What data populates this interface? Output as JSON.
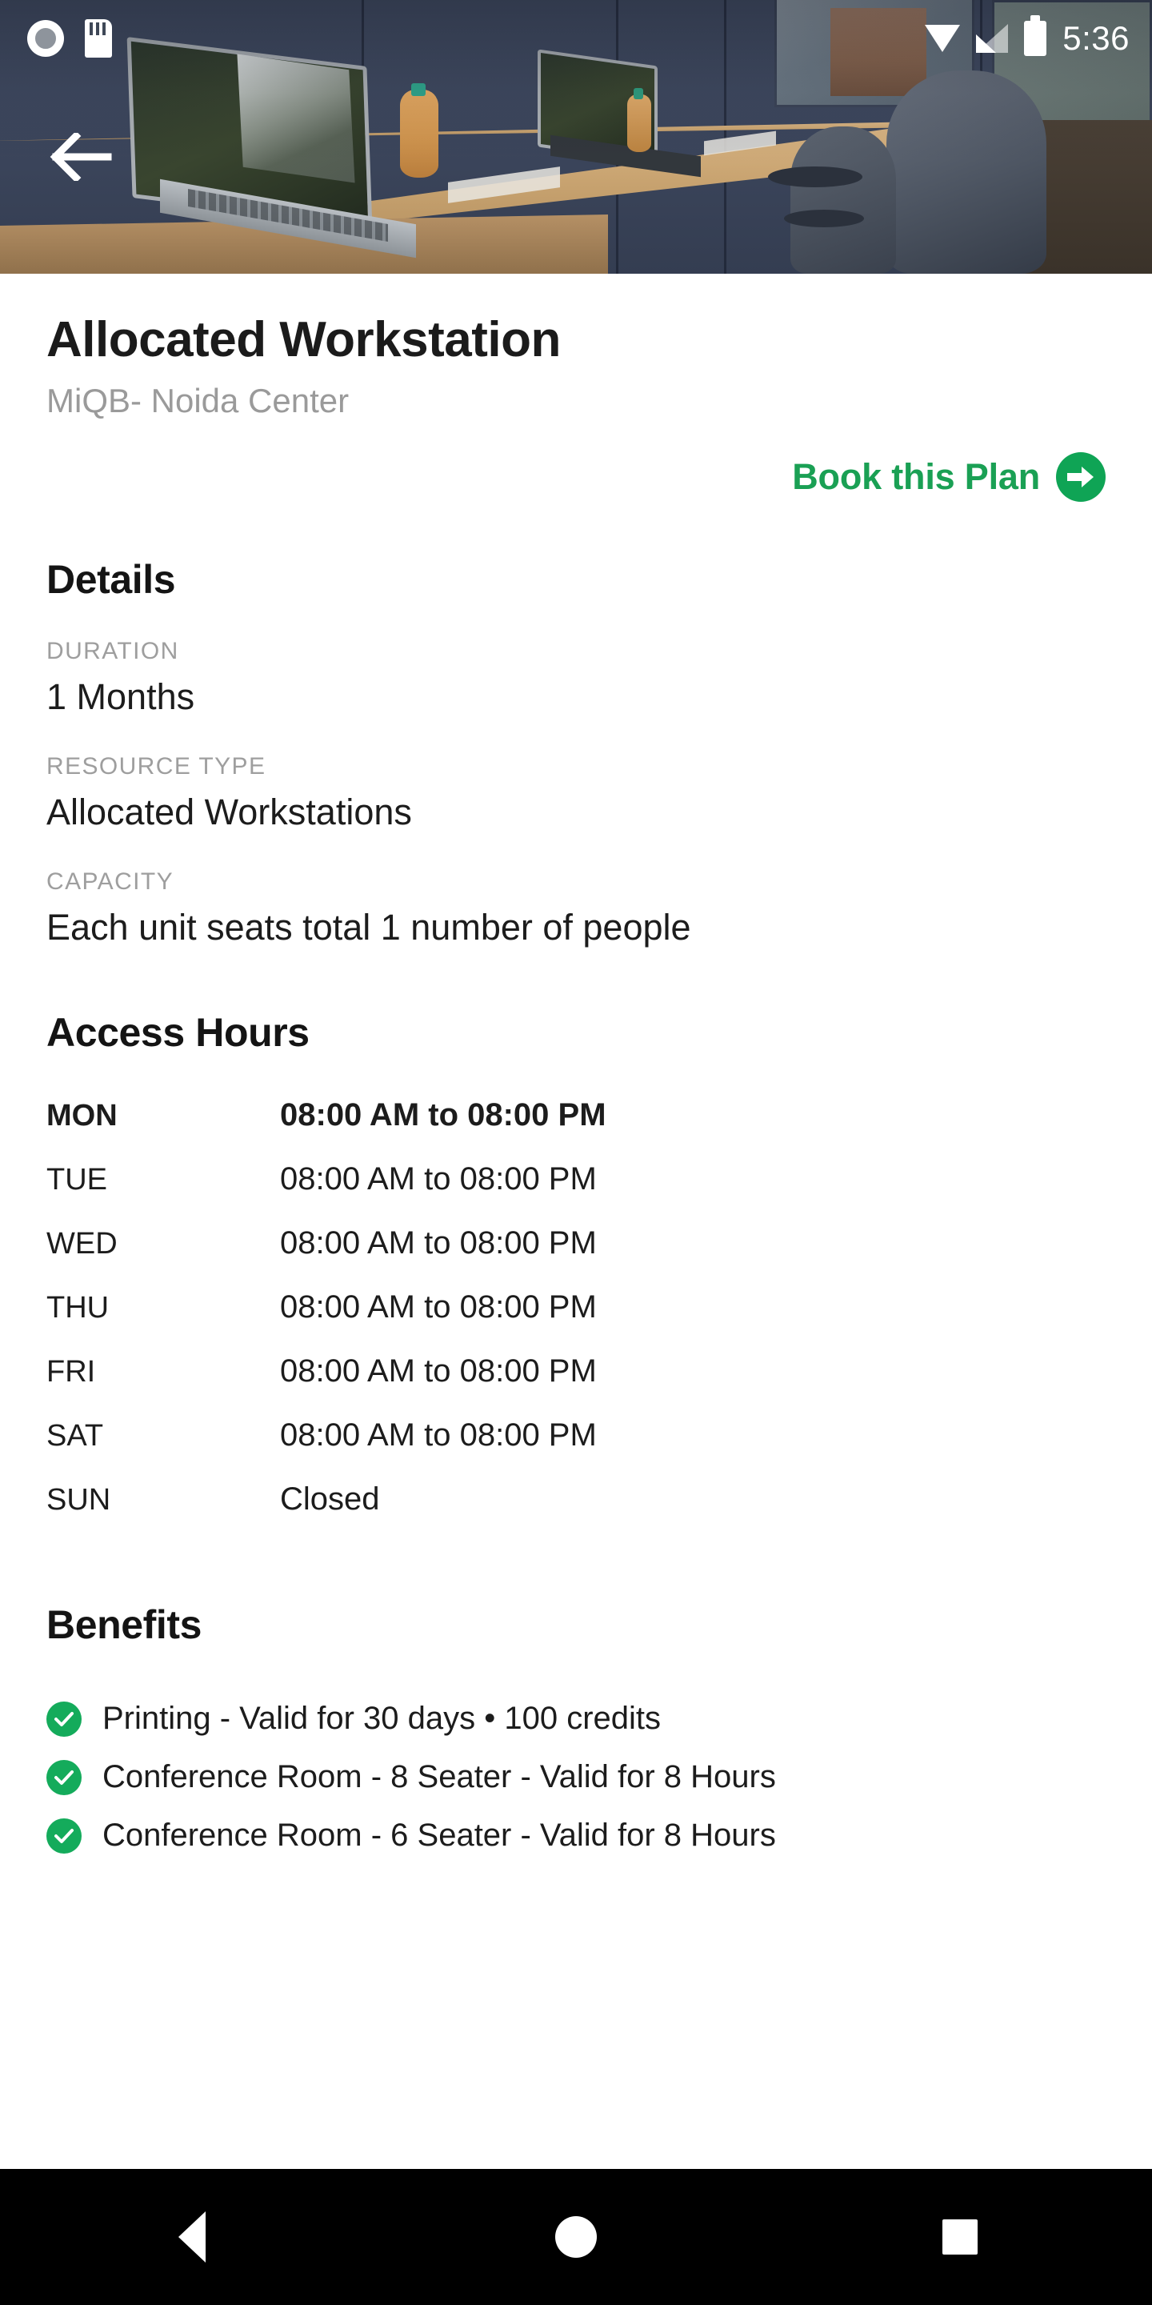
{
  "status_bar": {
    "time": "5:36",
    "icons": [
      "screen-record-icon",
      "sd-card-icon",
      "wifi-icon",
      "signal-icon",
      "battery-icon"
    ]
  },
  "hero": {
    "back_icon": "back-arrow-icon",
    "image_description": "Coworking space with laptops on a long wooden desk"
  },
  "header": {
    "title": "Allocated Workstation",
    "subtitle": "MiQB- Noida Center"
  },
  "book_cta": {
    "label": "Book this Plan",
    "icon": "arrow-right-circle-icon",
    "color": "#0fa455"
  },
  "details": {
    "heading": "Details",
    "fields": [
      {
        "label": "DURATION",
        "value": "1 Months"
      },
      {
        "label": "RESOURCE TYPE",
        "value": "Allocated Workstations"
      },
      {
        "label": "CAPACITY",
        "value": "Each unit seats total 1 number of people"
      }
    ]
  },
  "access_hours": {
    "heading": "Access Hours",
    "rows": [
      {
        "day": "MON",
        "time": "08:00 AM to 08:00 PM",
        "highlight": true
      },
      {
        "day": "TUE",
        "time": "08:00 AM to 08:00 PM",
        "highlight": false
      },
      {
        "day": "WED",
        "time": "08:00 AM to 08:00 PM",
        "highlight": false
      },
      {
        "day": "THU",
        "time": "08:00 AM to 08:00 PM",
        "highlight": false
      },
      {
        "day": "FRI",
        "time": "08:00 AM to 08:00 PM",
        "highlight": false
      },
      {
        "day": "SAT",
        "time": "08:00 AM to 08:00 PM",
        "highlight": false
      },
      {
        "day": "SUN",
        "time": "Closed",
        "highlight": false
      }
    ]
  },
  "benefits": {
    "heading": "Benefits",
    "items": [
      {
        "text": "Printing - Valid for 30 days  • 100 credits",
        "icon": "check-circle-icon"
      },
      {
        "text": "Conference Room - 8 Seater - Valid for 8 Hours",
        "icon": "check-circle-icon"
      },
      {
        "text": "Conference Room - 6 Seater - Valid for 8 Hours",
        "icon": "check-circle-icon"
      }
    ]
  },
  "nav_bar": {
    "back": "nav-back-icon",
    "home": "nav-home-icon",
    "recents": "nav-recents-icon"
  }
}
